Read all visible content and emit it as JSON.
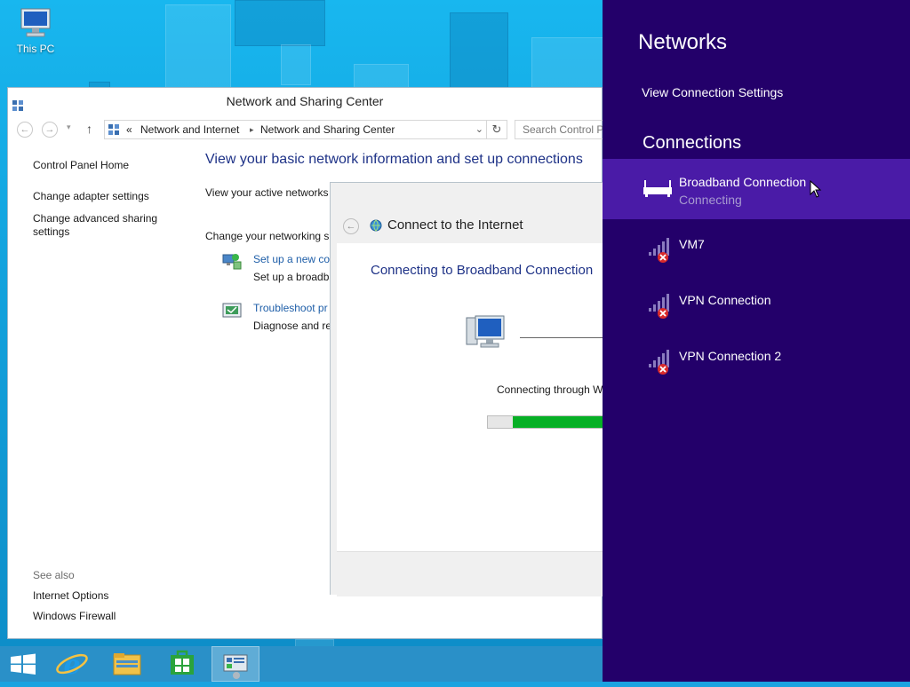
{
  "desktop": {
    "icons": [
      {
        "label": "This PC",
        "icon": "computer-icon"
      }
    ]
  },
  "window": {
    "title": "Network and Sharing Center",
    "address": {
      "separator_prefix": "«",
      "breadcrumbs": [
        "Network and Internet",
        "Network and Sharing Center"
      ],
      "search_placeholder": "Search Control Pa"
    },
    "left_nav": {
      "links": [
        "Control Panel Home",
        "Change adapter settings",
        "Change advanced sharing settings"
      ],
      "see_also_label": "See also",
      "see_also_links": [
        "Internet Options",
        "Windows Firewall"
      ]
    },
    "main": {
      "heading": "View your basic network information and set up connections",
      "active_networks_label": "View your active networks",
      "change_settings_label": "Change your networking s",
      "tasks": [
        {
          "link": "Set up a new con",
          "desc": "Set up a broadba",
          "icon": "network-setup-icon"
        },
        {
          "link": "Troubleshoot pr",
          "desc": "Diagnose and re",
          "icon": "troubleshoot-icon"
        }
      ]
    }
  },
  "dialog": {
    "title": "Connect to the Internet",
    "heading": "Connecting to Broadband Connection",
    "status": "Connecting through W",
    "progress": 0.78
  },
  "taskbar": {
    "items": [
      "start-icon",
      "internet-explorer-icon",
      "file-explorer-icon",
      "store-icon",
      "control-panel-icon"
    ]
  },
  "charms": {
    "title": "Networks",
    "settings_link": "View Connection Settings",
    "section": "Connections",
    "networks": [
      {
        "name": "Broadband Connection",
        "status": "Connecting",
        "icon": "broadband-icon",
        "selected": true
      },
      {
        "name": "VM7",
        "status": "",
        "icon": "wifi-disconnected-icon",
        "selected": false
      },
      {
        "name": "VPN Connection",
        "status": "",
        "icon": "wifi-disconnected-icon",
        "selected": false
      },
      {
        "name": "VPN Connection 2",
        "status": "",
        "icon": "wifi-disconnected-icon",
        "selected": false
      }
    ]
  },
  "colors": {
    "charm_bg": "#23006a",
    "charm_selected": "#4a1ba7",
    "link_blue": "#1e3287",
    "progress_green": "#06b025"
  }
}
